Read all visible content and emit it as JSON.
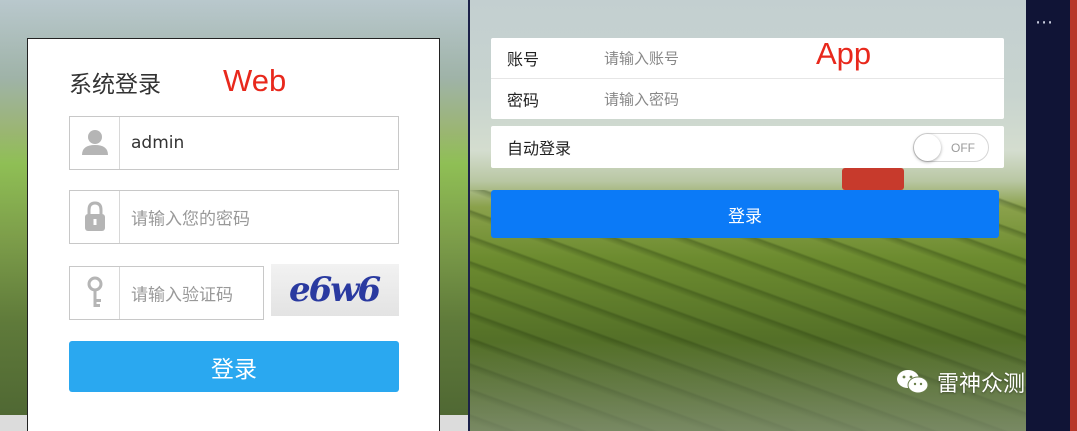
{
  "web": {
    "tag": "Web",
    "title": "系统登录",
    "username_value": "admin",
    "password_placeholder": "请输入您的密码",
    "captcha_placeholder": "请输入验证码",
    "captcha_text": "e6w6",
    "login_button": "登录",
    "icons": [
      "user-icon",
      "lock-icon",
      "key-icon"
    ]
  },
  "app": {
    "tag": "App",
    "account_label": "账号",
    "account_placeholder": "请输入账号",
    "password_label": "密码",
    "password_placeholder": "请输入密码",
    "auto_login_label": "自动登录",
    "auto_login_state": "OFF",
    "login_button": "登录"
  },
  "watermark": {
    "text": "雷神众测",
    "icon": "wechat-icon"
  },
  "sidebar": {
    "menu_icon": "more-dots-icon"
  },
  "colors": {
    "annotation_red": "#e8281c",
    "web_button": "#2aa8f0",
    "app_button": "#0b7af7"
  }
}
